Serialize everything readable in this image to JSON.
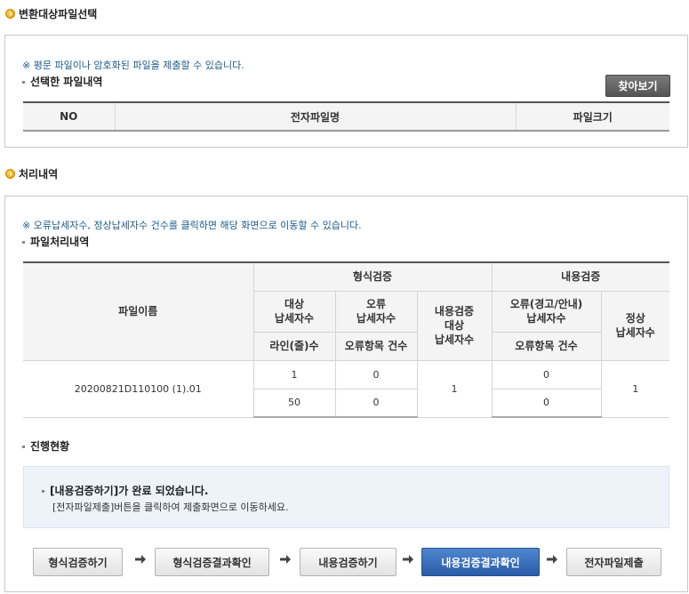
{
  "section1": {
    "title": "변환대상파일선택",
    "note": "※ 평문 파일이나 암호화된 파일을 제출할 수 있습니다.",
    "subtitle": "선택한 파일내역",
    "browse_button": "찾아보기",
    "table_headers": [
      "NO",
      "전자파일명",
      "파일크기"
    ]
  },
  "section2": {
    "title": "처리내역",
    "note": "※ 오류납세자수, 정상납세자수 건수를 클릭하면 해당 화면으로 이동할 수 있습니다.",
    "subtitle": "파일처리내역",
    "headers": {
      "filename": "파일이름",
      "format_check": "형식검증",
      "content_check": "내용검증",
      "target_taxpayers_1": "대상",
      "target_taxpayers_2": "납세자수",
      "error_1": "오류",
      "error_2": "납세자수",
      "content_target_1": "내용검증",
      "content_target_2": "대상",
      "content_target_3": "납세자수",
      "content_error_1": "오류(경고/안내)",
      "content_error_2": "납세자수",
      "normal_1": "정상",
      "normal_2": "납세자수",
      "lines": "라인(줄)수",
      "error_items": "오류항목 건수",
      "content_error_items": "오류항목 건수"
    },
    "row": {
      "filename": "20200821D110100 (1).01",
      "target_taxpayers": "1",
      "lines": "50",
      "error_taxpayers": "0",
      "error_items": "0",
      "content_target": "1",
      "content_error_taxpayers": "0",
      "content_error_items": "0",
      "normal_taxpayers": "1"
    }
  },
  "progress": {
    "subtitle": "진행현황",
    "message": "[내용검증하기]가 완료 되었습니다.",
    "submessage": "[전자파일제출]버튼을 클릭하여 제출화면으로 이동하세요.",
    "steps": [
      "형식검증하기",
      "형식검증결과확인",
      "내용검증하기",
      "내용검증결과확인",
      "전자파일제출"
    ],
    "active_step": "내용검증결과확인"
  }
}
